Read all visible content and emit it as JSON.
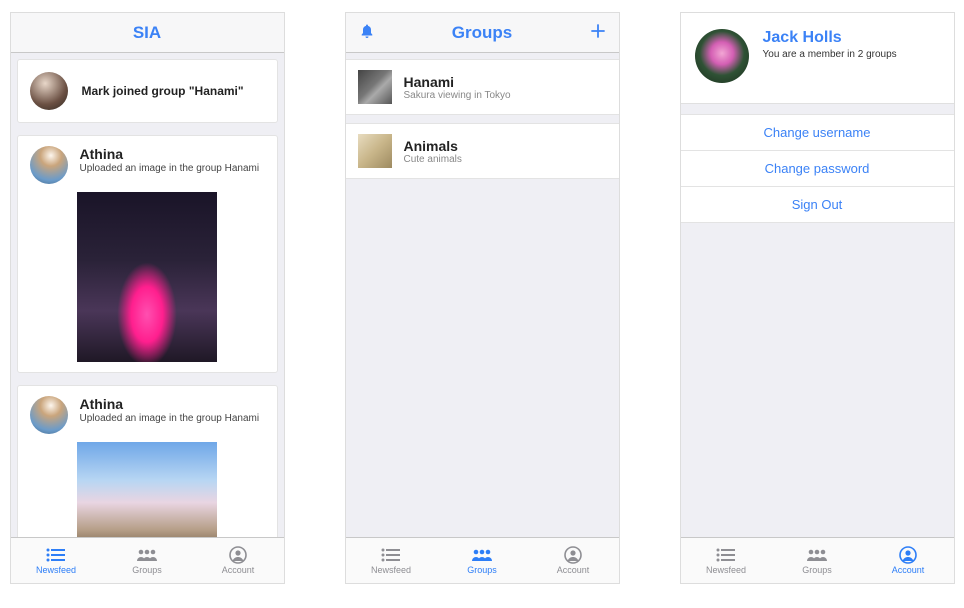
{
  "screens": {
    "newsfeed": {
      "title": "SIA",
      "joincard": {
        "text": "Mark joined group \"Hanami\""
      },
      "posts": [
        {
          "author": "Athina",
          "desc": "Uploaded an image in the group Hanami"
        },
        {
          "author": "Athina",
          "desc": "Uploaded an image in the group Hanami"
        }
      ]
    },
    "groups": {
      "title": "Groups",
      "items": [
        {
          "name": "Hanami",
          "desc": "Sakura viewing in Tokyo"
        },
        {
          "name": "Animals",
          "desc": "Cute animals"
        }
      ]
    },
    "account": {
      "name": "Jack Holls",
      "subtitle": "You are a member in 2 groups",
      "actions": {
        "change_username": "Change username",
        "change_password": "Change password",
        "sign_out": "Sign Out"
      }
    }
  },
  "tabs": {
    "newsfeed": "Newsfeed",
    "groups": "Groups",
    "account": "Account"
  }
}
